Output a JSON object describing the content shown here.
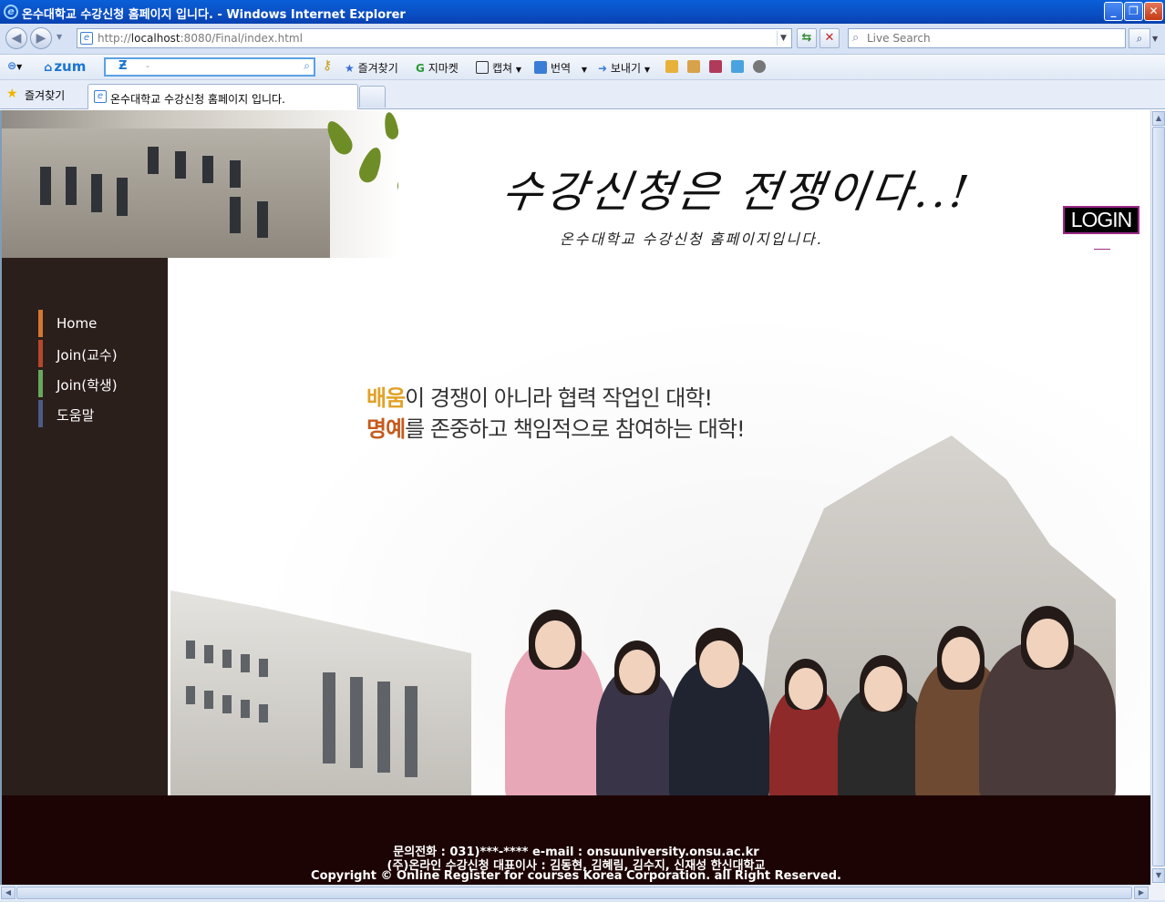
{
  "browser": {
    "title": "온수대학교 수강신청 홈페이지 입니다. - Windows Internet Explorer",
    "address": {
      "url_prefix": "http://",
      "url_host": "localhost",
      "url_rest": ":8080/Final/index.html"
    },
    "search": {
      "placeholder": "Live Search"
    },
    "toolbar": {
      "zum_logo": "zum",
      "zum_search_value": "-",
      "items": [
        {
          "label": "즐겨찾기",
          "icon": "favorites-star-icon"
        },
        {
          "label": "지마켓",
          "icon": "gmarket-icon"
        },
        {
          "label": "캡쳐",
          "icon": "capture-icon"
        },
        {
          "label": "번역",
          "icon": "translate-icon"
        },
        {
          "label": "보내기",
          "icon": "send-icon"
        }
      ]
    },
    "favorites_label": "즐겨찾기",
    "tab_label": "온수대학교 수강신청 홈페이지 입니다."
  },
  "header": {
    "slogan": "수강신청은 전쟁이다..!",
    "subslogan": "온수대학교 수강신청 홈페이지입니다.",
    "login_label": "LOGIN"
  },
  "sidebar": {
    "items": [
      {
        "label": "Home",
        "color": "#d3772f"
      },
      {
        "label": "Join(교수)",
        "color": "#b5472c"
      },
      {
        "label": "Join(학생)",
        "color": "#67a85d"
      },
      {
        "label": "도움말",
        "color": "#4b5b85"
      }
    ]
  },
  "hero": {
    "line1_highlight": "배움",
    "line1_rest": "이 경쟁이 아니라 협력 작업인 대학!",
    "line1_color": "#e2a126",
    "line2_highlight": "명예",
    "line2_rest": "를 존중하고 책임적으로 참여하는 대학!",
    "line2_color": "#c65a1c"
  },
  "footer": {
    "line1": "문의전화 : 031)***-****    e-mail : onsuuniversity.onsu.ac.kr",
    "line2": "(주)온라인 수강신청 대표이사 : 김동현, 김혜림, 김수지, 신재성 한신대학교",
    "line3": "Copyright © Online Register for courses Korea Corporation. all Right Reserved."
  }
}
